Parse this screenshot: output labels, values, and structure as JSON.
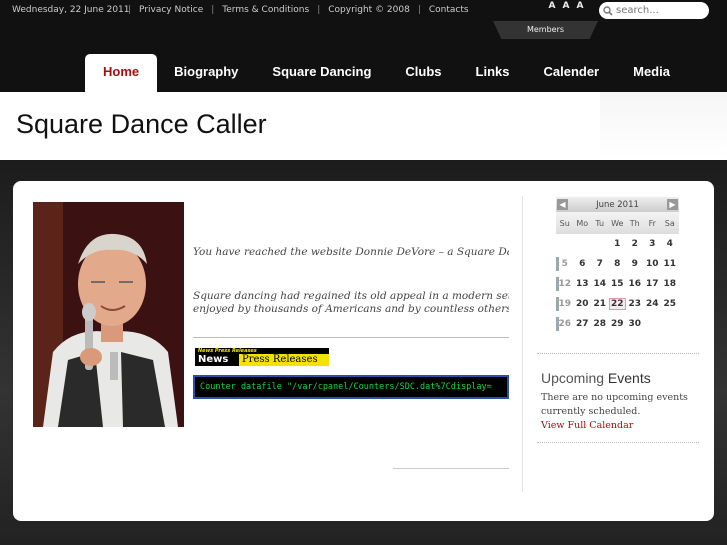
{
  "topbar": {
    "date": "Wednesday, 22 June 2011",
    "links": [
      "Privacy Notice",
      "Terms & Conditions",
      "Copyright © 2008",
      "Contacts"
    ],
    "font_sizes": [
      "A",
      "A",
      "A"
    ],
    "search_placeholder": "search...",
    "members_label": "Members"
  },
  "nav": {
    "tabs": [
      "Home",
      "Biography",
      "Square Dancing",
      "Clubs",
      "Links",
      "Calender",
      "Media"
    ],
    "active": "Home"
  },
  "header": {
    "title": "Square Dance Caller"
  },
  "main": {
    "intro": "You have reached the website Donnie DeVore – a Square Dance",
    "para_line1": "Square dancing had regained its old appeal in a modern setting",
    "para_line2": "enjoyed by thousands of Americans and by countless others aro",
    "news_label_small": "News Press Releases",
    "news_label_big_left": "News",
    "news_label_big_right": "Press Releases",
    "counter_text": "Counter datafile \"/var/cpanel/Counters/SDC.dat%7Cdisplay="
  },
  "calendar": {
    "month": "June 2011",
    "prev": "◀",
    "next": "▶",
    "dows": [
      "Su",
      "Mo",
      "Tu",
      "We",
      "Th",
      "Fr",
      "Sa"
    ],
    "weeks": [
      [
        "",
        "",
        "",
        "1",
        "2",
        "3",
        "4"
      ],
      [
        "5",
        "6",
        "7",
        "8",
        "9",
        "10",
        "11"
      ],
      [
        "12",
        "13",
        "14",
        "15",
        "16",
        "17",
        "18"
      ],
      [
        "19",
        "20",
        "21",
        "22",
        "23",
        "24",
        "25"
      ],
      [
        "26",
        "27",
        "28",
        "29",
        "30",
        "",
        ""
      ]
    ],
    "today": "22"
  },
  "events": {
    "title_light": "Upcoming",
    "title_strong": "Events",
    "text": "There are no upcoming events currently scheduled.",
    "link": "View Full Calendar"
  },
  "colors": {
    "accent": "#a01010",
    "counter_text": "#19d24a",
    "counter_border": "#2d4fa8"
  }
}
